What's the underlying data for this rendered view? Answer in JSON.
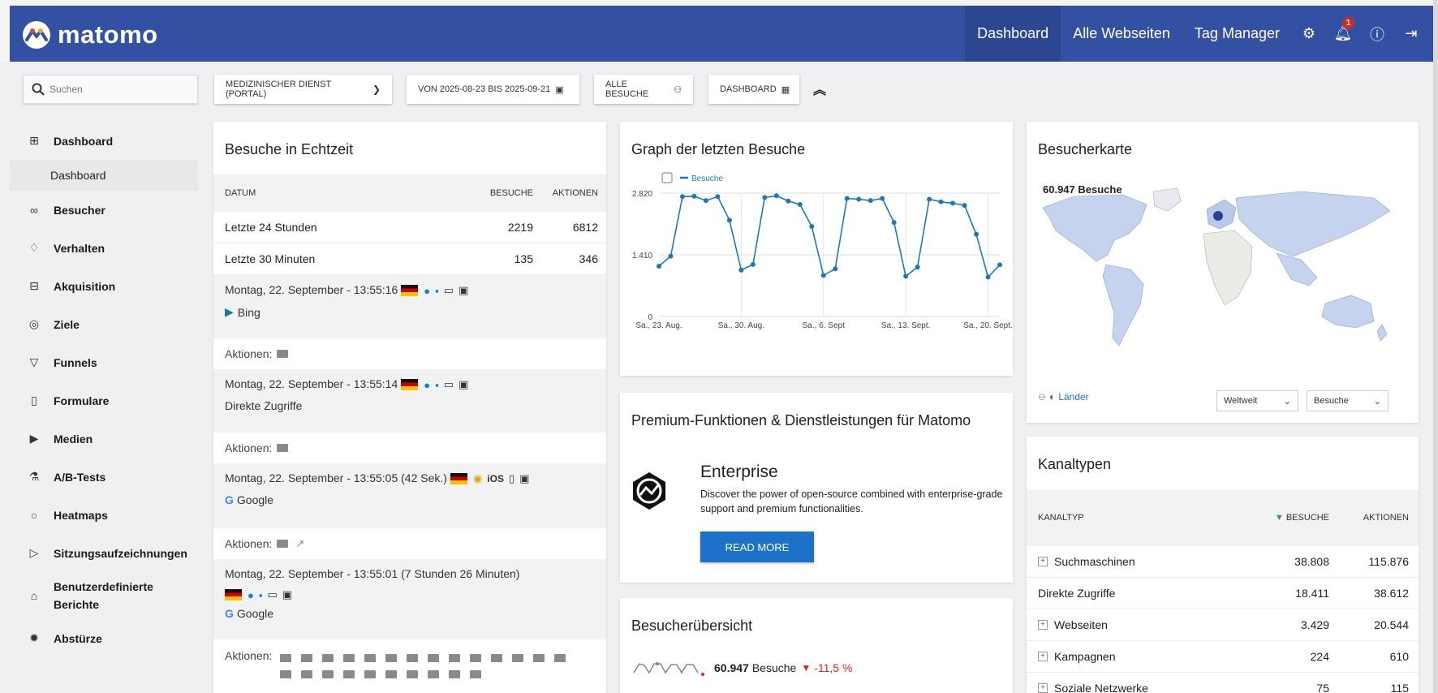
{
  "header": {
    "logo_text": "matomo",
    "nav": [
      "Dashboard",
      "Alle Webseiten",
      "Tag Manager"
    ],
    "notification_count": "1"
  },
  "controls": {
    "search_placeholder": "Suchen",
    "site_selector": "MEDIZINISCHER DIENST (PORTAL)",
    "period_selector": "VON 2025-08-23 BIS 2025-09-21",
    "segment_selector": "ALLE BESUCHE",
    "dashboard_selector": "DASHBOARD"
  },
  "sidebar": {
    "items": [
      {
        "label": "Dashboard",
        "icon": "grid-icon"
      },
      {
        "label": "Besucher",
        "icon": "glasses-icon"
      },
      {
        "label": "Verhalten",
        "icon": "bell-icon"
      },
      {
        "label": "Akquisition",
        "icon": "window-icon"
      },
      {
        "label": "Ziele",
        "icon": "target-icon"
      },
      {
        "label": "Funnels",
        "icon": "funnel-icon"
      },
      {
        "label": "Formulare",
        "icon": "clipboard-icon"
      },
      {
        "label": "Medien",
        "icon": "media-icon"
      },
      {
        "label": "A/B-Tests",
        "icon": "flask-icon"
      },
      {
        "label": "Heatmaps",
        "icon": "flame-icon"
      },
      {
        "label": "Sitzungsaufzeichnungen",
        "icon": "play-icon"
      },
      {
        "label": "Benutzerdefinierte Berichte",
        "icon": "bank-icon"
      },
      {
        "label": "Abstürze",
        "icon": "bug-icon"
      }
    ],
    "sub_item": "Dashboard"
  },
  "realtime": {
    "title": "Besuche in Echtzeit",
    "columns": [
      "DATUM",
      "BESUCHE",
      "AKTIONEN"
    ],
    "rows": [
      {
        "label": "Letzte 24 Stunden",
        "visits": "2219",
        "actions": "6812"
      },
      {
        "label": "Letzte 30 Minuten",
        "visits": "135",
        "actions": "346"
      }
    ],
    "visits": [
      {
        "time": "Montag, 22. September - 13:55:16",
        "referrer": "Bing",
        "actions_label": "Aktionen:"
      },
      {
        "time": "Montag, 22. September - 13:55:14",
        "referrer": "Direkte Zugriffe",
        "actions_label": "Aktionen:"
      },
      {
        "time": "Montag, 22. September - 13:55:05 (42 Sek.)",
        "os": "iOS",
        "referrer": "Google",
        "actions_label": "Aktionen:"
      },
      {
        "time": "Montag, 22. September - 13:55:01 (7 Stunden 26 Minuten)",
        "referrer": "Google",
        "actions_label": "Aktionen:"
      }
    ]
  },
  "graph": {
    "title": "Graph der letzten Besuche",
    "legend": "Besuche",
    "y_ticks": [
      "2.820",
      "1.410",
      "0"
    ],
    "x_ticks": [
      "Sa., 23. Aug.",
      "Sa., 30. Aug.",
      "Sa., 6. Sept",
      "Sa., 13. Sept.",
      "Sa., 20. Sept."
    ]
  },
  "chart_data": {
    "type": "line",
    "ylim": [
      0,
      2820
    ],
    "series": [
      {
        "name": "Besuche",
        "values": [
          1150,
          1380,
          2740,
          2750,
          2650,
          2740,
          2200,
          1060,
          1190,
          2720,
          2760,
          2640,
          2560,
          2060,
          940,
          1090,
          2700,
          2680,
          2650,
          2700,
          2150,
          920,
          1130,
          2680,
          2620,
          2590,
          2540,
          1880,
          900,
          1180
        ]
      }
    ]
  },
  "premium": {
    "title": "Premium-Funktionen & Dienstleistungen für Matomo",
    "product": "Enterprise",
    "description": "Discover the power of open-source combined with enterprise-grade support and premium functionalities.",
    "button": "READ MORE"
  },
  "overview": {
    "title": "Besucherübersicht",
    "value": "60.947",
    "value_label": "Besuche",
    "change": "-11,5 %"
  },
  "map": {
    "title": "Besucherkarte",
    "total_label": "60.947 Besuche",
    "link": "Länder",
    "region_select": "Weltweit",
    "metric_select": "Besuche"
  },
  "channels": {
    "title": "Kanaltypen",
    "columns": [
      "KANALTYP",
      "BESUCHE",
      "AKTIONEN"
    ],
    "rows": [
      {
        "label": "Suchmaschinen",
        "visits": "38.808",
        "actions": "115.876"
      },
      {
        "label": "Direkte Zugriffe",
        "visits": "18.411",
        "actions": "38.612"
      },
      {
        "label": "Webseiten",
        "visits": "3.429",
        "actions": "20.544"
      },
      {
        "label": "Kampagnen",
        "visits": "224",
        "actions": "610"
      },
      {
        "label": "Soziale Netzwerke",
        "visits": "75",
        "actions": "115"
      }
    ]
  }
}
